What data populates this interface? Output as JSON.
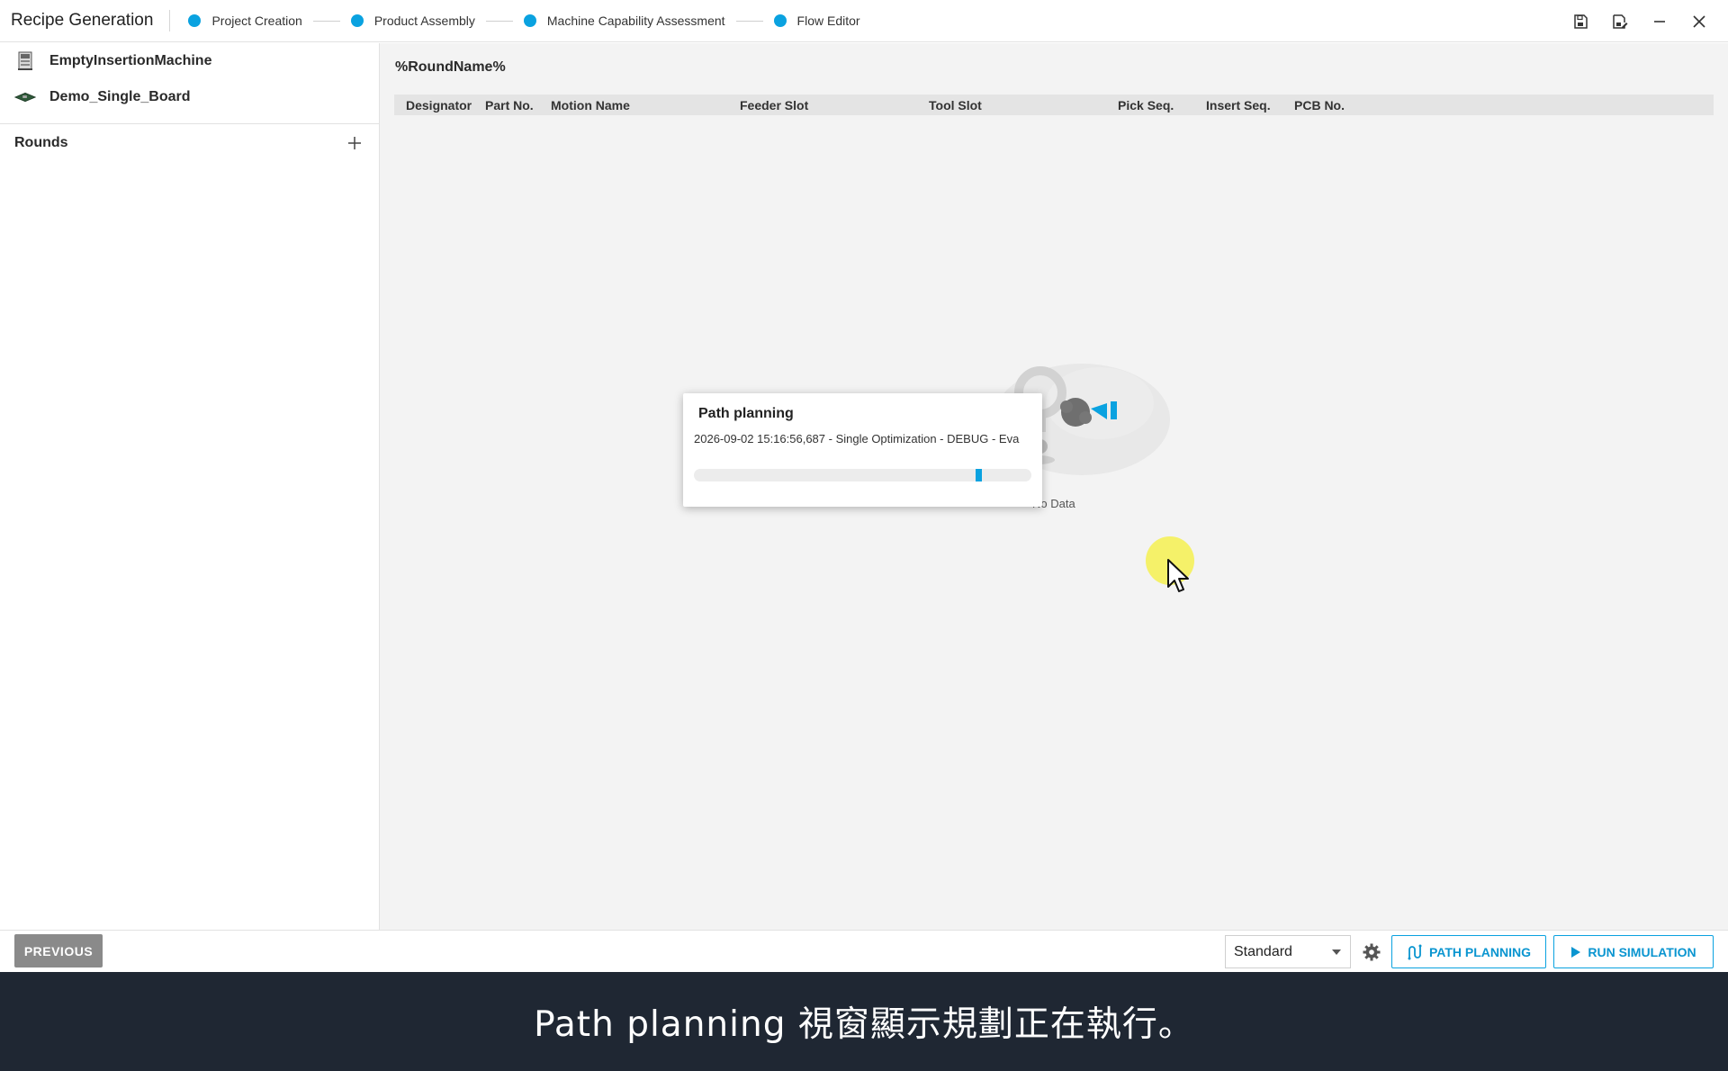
{
  "header": {
    "app_title": "Recipe Generation",
    "steps": [
      {
        "label": "Project Creation"
      },
      {
        "label": "Product Assembly"
      },
      {
        "label": "Machine Capability Assessment"
      },
      {
        "label": "Flow Editor"
      }
    ],
    "step_color": "#0aa2e0"
  },
  "sidebar": {
    "resources": [
      {
        "label": "EmptyInsertionMachine",
        "icon": "machine-icon"
      },
      {
        "label": "Demo_Single_Board",
        "icon": "pcb-board-icon"
      }
    ],
    "rounds_label": "Rounds"
  },
  "main": {
    "round_name": "%RoundName%",
    "columns": [
      "Designator",
      "Part No.",
      "Motion Name",
      "Feeder Slot",
      "Tool Slot",
      "Pick Seq.",
      "Insert Seq.",
      "PCB No."
    ],
    "empty_text": "No Data"
  },
  "dialog": {
    "title": "Path planning",
    "log_line": "2026-09-02 15:16:56,687 - Single Optimization - DEBUG - Eva",
    "progress_marker_fraction": 0.85
  },
  "footer": {
    "previous_label": "PREVIOUS",
    "mode_value": "Standard",
    "path_planning_label": "PATH PLANNING",
    "run_simulation_label": "RUN SIMULATION",
    "accent": "#0aa2e0"
  },
  "caption": {
    "text": "Path planning 視窗顯示規劃正在執行。"
  }
}
